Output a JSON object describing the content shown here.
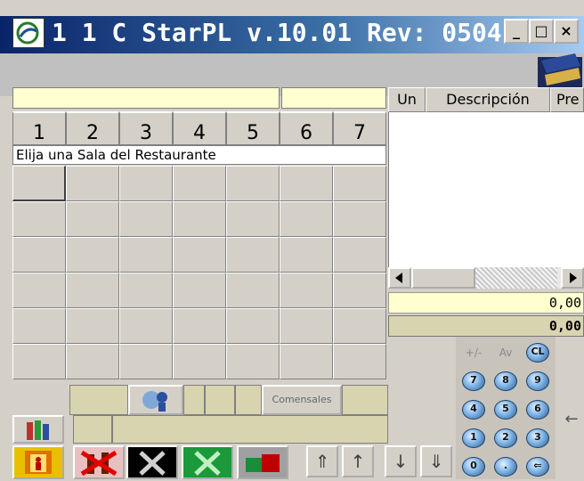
{
  "window": {
    "title": "1 1 C StarPL  v.10.01   Rev: 0504...",
    "min_glyph": "_",
    "max_glyph": "□",
    "close_glyph": "×"
  },
  "tabs": [
    "1",
    "2",
    "3",
    "4",
    "5",
    "6",
    "7"
  ],
  "prompt": "Elija una Sala del Restaurante",
  "list": {
    "headers": [
      "Un",
      "Descripción",
      "Pre"
    ]
  },
  "totals": [
    "0,00",
    "0,00"
  ],
  "keypad": {
    "labels": [
      "+/-",
      "Av",
      "CL",
      "7",
      "8",
      "9",
      "4",
      "5",
      "6",
      "1",
      "2",
      "3",
      "0",
      ".",
      "⇐"
    ]
  },
  "comensales_label": "Comensales",
  "arrows": [
    "⇑",
    "↑",
    "↓",
    "⇓"
  ],
  "right_arrow": "←",
  "colors": {
    "yellow": "#ffffd0",
    "accent_red": "#c00000",
    "accent_green": "#1a8c3a"
  }
}
